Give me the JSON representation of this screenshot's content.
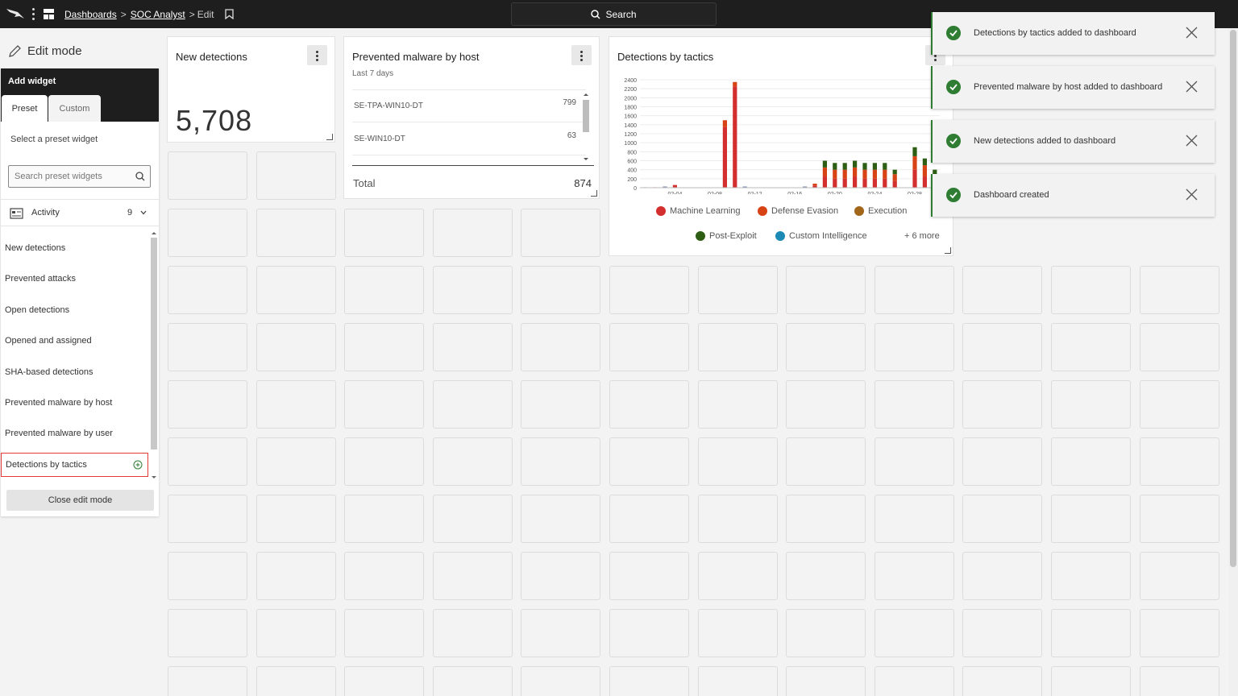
{
  "topbar": {
    "breadcrumb": {
      "dashboards": "Dashboards",
      "soc_analyst": "SOC Analyst",
      "edit": "Edit",
      "separator": ">"
    },
    "search_label": "Search"
  },
  "edit_mode_label": "Edit mode",
  "add_widget": {
    "title": "Add widget",
    "tabs": [
      "Preset",
      "Custom"
    ],
    "select_label": "Select a preset widget",
    "search_placeholder": "Search preset widgets",
    "category": {
      "label": "Activity",
      "count": "9"
    },
    "items": [
      "New detections",
      "Prevented attacks",
      "Open detections",
      "Opened and assigned",
      "SHA-based detections",
      "Prevented malware by host",
      "Prevented malware by user",
      "Detections by tactics"
    ],
    "close_label": "Close edit mode"
  },
  "widgets": {
    "new_detections": {
      "title": "New detections",
      "value": "5,708"
    },
    "prevented_malware": {
      "title": "Prevented malware by host",
      "subtitle": "Last 7 days",
      "rows": [
        {
          "host": "SE-TPA-WIN10-DT",
          "count": "799"
        },
        {
          "host": "SE-WIN10-DT",
          "count": "63"
        }
      ],
      "total_label": "Total",
      "total_value": "874"
    },
    "tactics": {
      "title": "Detections by tactics",
      "legend": [
        {
          "name": "Machine Learning",
          "color": "#d32f2f"
        },
        {
          "name": "Defense Evasion",
          "color": "#d84315"
        },
        {
          "name": "Execution",
          "color": "#a1661a"
        },
        {
          "name": "Post-Exploit",
          "color": "#2e5e14"
        },
        {
          "name": "Custom Intelligence",
          "color": "#1b8ab5"
        }
      ],
      "more_label": "+ 6 more"
    }
  },
  "chart_data": {
    "type": "bar",
    "title": "Detections by tactics",
    "yticks": [
      "2400",
      "2200",
      "2000",
      "1800",
      "1600",
      "1400",
      "1200",
      "1000",
      "800",
      "600",
      "400",
      "200",
      "0"
    ],
    "ylim": [
      0,
      2400
    ],
    "xticks": [
      "02-04",
      "02-08",
      "02-12",
      "02-16",
      "02-20",
      "02-24",
      "02-28"
    ],
    "series": [
      {
        "name": "Machine Learning",
        "values": [
          10,
          10,
          0,
          60,
          0,
          0,
          0,
          0,
          1350,
          2250,
          0,
          0,
          0,
          0,
          0,
          0,
          0,
          50,
          250,
          200,
          200,
          250,
          200,
          200,
          200,
          150,
          0,
          400,
          250,
          150
        ]
      },
      {
        "name": "Defense Evasion",
        "values": [
          0,
          0,
          0,
          0,
          0,
          0,
          0,
          0,
          150,
          100,
          0,
          0,
          0,
          0,
          0,
          0,
          0,
          40,
          200,
          200,
          200,
          200,
          200,
          200,
          200,
          150,
          0,
          300,
          250,
          150
        ]
      },
      {
        "name": "Post-Exploit",
        "values": [
          0,
          0,
          0,
          0,
          0,
          0,
          0,
          0,
          0,
          0,
          0,
          0,
          0,
          0,
          0,
          0,
          0,
          0,
          150,
          150,
          150,
          150,
          150,
          150,
          150,
          100,
          0,
          200,
          150,
          100
        ]
      }
    ]
  },
  "toasts": [
    "Detections by tactics added to dashboard",
    "Prevented malware by host added to dashboard",
    "New detections added to dashboard",
    "Dashboard created"
  ],
  "colors": {
    "accent_red": "#e53935",
    "success_green": "#2e7d32",
    "topbar": "#1e1e1e"
  }
}
